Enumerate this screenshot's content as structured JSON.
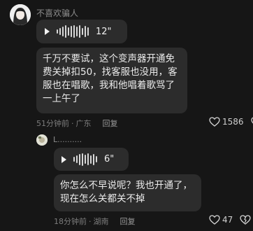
{
  "comment": {
    "username": "不喜欢骗人",
    "voice_duration": "12\"",
    "text": "千万不要试，这个变声器开通免费关掉扣50，找客服也没用，客服也在唱歌，我和他唱着歌骂了一上午了",
    "time": "51分钟前",
    "location": "广东",
    "reply_label": "回复",
    "likes": "1586"
  },
  "reply": {
    "username": "L..........",
    "voice_duration": "6\"",
    "text": "你怎么不早说呢？我也开通了，现在怎么关都关不掉",
    "time": "18分钟前",
    "location": "湖南",
    "reply_label": "回复",
    "likes": "47"
  },
  "separator": "·",
  "icons": [
    "avatar",
    "play-icon",
    "audio-wave",
    "heart-icon",
    "dislike-icon"
  ]
}
